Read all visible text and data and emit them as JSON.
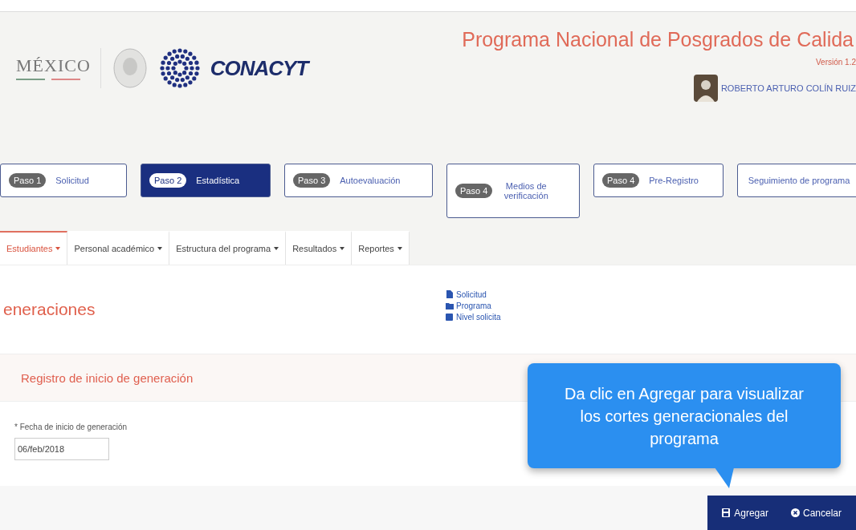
{
  "header": {
    "gov_logo_text": "MÉXICO",
    "brand": "CONACYT",
    "title": "Programa Nacional de Posgrados de Calida",
    "version": "Versión 1.2",
    "user": "ROBERTO ARTURO COLÍN RUIZ"
  },
  "steps": [
    {
      "badge": "Paso 1",
      "label": "Solicitud",
      "selected": false
    },
    {
      "badge": "Paso 2",
      "label": "Estadística",
      "selected": true
    },
    {
      "badge": "Paso 3",
      "label": "Autoevaluación",
      "selected": false
    },
    {
      "badge": "Paso 4",
      "label": "Medios de verificación",
      "selected": false
    },
    {
      "badge": "Paso 4",
      "label": "Pre-Registro",
      "selected": false
    },
    {
      "label": "Seguimiento de programa",
      "selected": false
    }
  ],
  "menu": [
    {
      "label": "Estudiantes",
      "selected": true
    },
    {
      "label": "Personal académico",
      "selected": false
    },
    {
      "label": "Estructura del programa",
      "selected": false
    },
    {
      "label": "Resultados",
      "selected": false
    },
    {
      "label": "Reportes",
      "selected": false
    }
  ],
  "page": {
    "title": "eneraciones",
    "links": [
      {
        "label": "Solicitud",
        "kind": "file"
      },
      {
        "label": "Programa",
        "kind": "folder"
      },
      {
        "label": "Nivel solicita",
        "kind": "square"
      }
    ],
    "panel_title": "Registro de inicio de generación",
    "field": {
      "label": "* Fecha de inicio de generación",
      "value": "06/feb/2018"
    }
  },
  "tooltip": {
    "text": "Da clic en Agregar para visualizar los cortes generacionales del programa"
  },
  "actions": [
    {
      "label": "Agregar",
      "kind": "save"
    },
    {
      "label": "Cancelar",
      "kind": "cancel"
    }
  ]
}
